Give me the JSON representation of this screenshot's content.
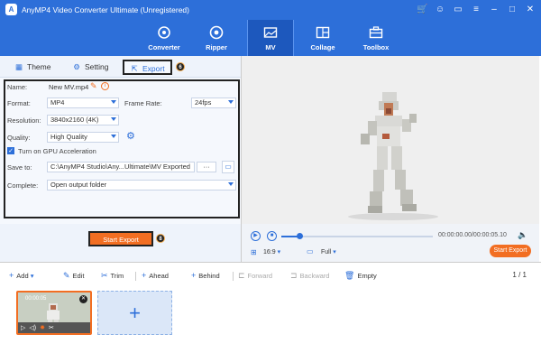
{
  "titlebar": {
    "title": "AnyMP4 Video Converter Ultimate (Unregistered)",
    "icons": [
      "cart-icon",
      "user-icon",
      "chat-icon",
      "menu-icon",
      "minimize-icon",
      "maximize-icon",
      "close-icon"
    ]
  },
  "nav": {
    "items": [
      {
        "label": "Converter",
        "icon": "converter-icon"
      },
      {
        "label": "Ripper",
        "icon": "ripper-icon"
      },
      {
        "label": "MV",
        "icon": "mv-icon",
        "active": true
      },
      {
        "label": "Collage",
        "icon": "collage-icon"
      },
      {
        "label": "Toolbox",
        "icon": "toolbox-icon"
      }
    ]
  },
  "tabs": {
    "theme": "Theme",
    "setting": "Setting",
    "export": "Export",
    "export_badge": "6"
  },
  "export_settings": {
    "name_label": "Name:",
    "name_value": "New MV.mp4",
    "format_label": "Format:",
    "format_value": "MP4",
    "framerate_label": "Frame Rate:",
    "framerate_value": "24fps",
    "resolution_label": "Resolution:",
    "resolution_value": "3840x2160 (4K)",
    "quality_label": "Quality:",
    "quality_value": "High Quality",
    "gpu_label": "Turn on GPU Acceleration",
    "gpu_checked": true,
    "saveto_label": "Save to:",
    "saveto_value": "C:\\AnyMP4 Studio\\Any...Ultimate\\MV Exported",
    "saveto_more": "···",
    "complete_label": "Complete:",
    "complete_value": "Open output folder",
    "box_badge": "7"
  },
  "left_bottom": {
    "start_export": "Start Export",
    "badge": "8"
  },
  "player": {
    "time": "00:00:00.00/00:00:05.10",
    "ratio": "16:9",
    "view": "Full",
    "progress": 0.12,
    "start_export": "Start Export"
  },
  "toolbar": {
    "add": "Add",
    "edit": "Edit",
    "trim": "Trim",
    "ahead": "Ahead",
    "behind": "Behind",
    "forward": "Forward",
    "backward": "Backward",
    "empty": "Empty",
    "page": "1 / 1"
  },
  "clip": {
    "time": "00:00:05"
  },
  "colors": {
    "brand_blue": "#2d6fd9",
    "accent_orange": "#f26e22"
  }
}
